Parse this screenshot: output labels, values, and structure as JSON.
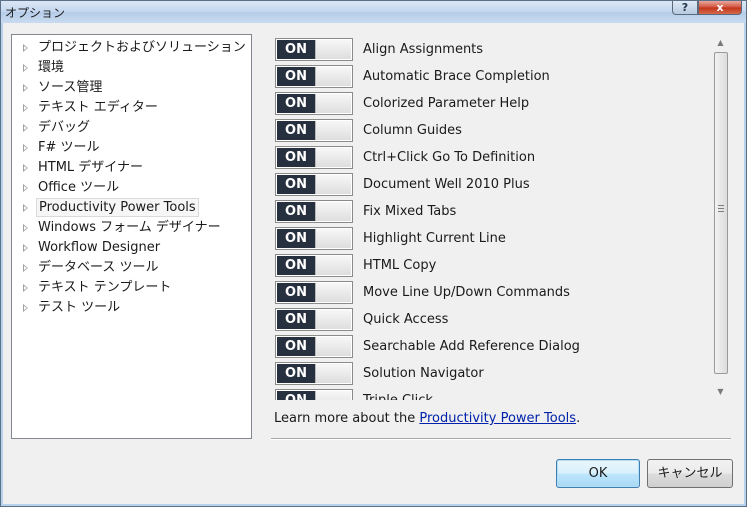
{
  "window": {
    "title": "オプション",
    "help_label": "?",
    "close_label": "x"
  },
  "tree": {
    "items": [
      {
        "label": "プロジェクトおよびソリューション"
      },
      {
        "label": "環境"
      },
      {
        "label": "ソース管理"
      },
      {
        "label": "テキスト エディター"
      },
      {
        "label": "デバッグ"
      },
      {
        "label": "F# ツール"
      },
      {
        "label": "HTML デザイナー"
      },
      {
        "label": "Office ツール"
      },
      {
        "label": "Productivity Power Tools",
        "selected": true
      },
      {
        "label": "Windows フォーム デザイナー"
      },
      {
        "label": "Workflow Designer"
      },
      {
        "label": "データベース ツール"
      },
      {
        "label": "テキスト テンプレート"
      },
      {
        "label": "テスト ツール"
      }
    ]
  },
  "options": {
    "items": [
      {
        "state": "ON",
        "label": "Align Assignments"
      },
      {
        "state": "ON",
        "label": "Automatic Brace Completion"
      },
      {
        "state": "ON",
        "label": "Colorized Parameter Help"
      },
      {
        "state": "ON",
        "label": "Column Guides"
      },
      {
        "state": "ON",
        "label": "Ctrl+Click Go To Definition"
      },
      {
        "state": "ON",
        "label": "Document Well 2010 Plus"
      },
      {
        "state": "ON",
        "label": "Fix Mixed Tabs"
      },
      {
        "state": "ON",
        "label": "Highlight Current Line"
      },
      {
        "state": "ON",
        "label": "HTML Copy"
      },
      {
        "state": "ON",
        "label": "Move Line Up/Down Commands"
      },
      {
        "state": "ON",
        "label": "Quick Access"
      },
      {
        "state": "ON",
        "label": "Searchable Add Reference Dialog"
      },
      {
        "state": "ON",
        "label": "Solution Navigator"
      },
      {
        "state": "ON",
        "label": "Triple Click"
      }
    ]
  },
  "learn_more": {
    "prefix": "Learn more about the ",
    "link": "Productivity Power Tools",
    "suffix": "."
  },
  "buttons": {
    "ok": "OK",
    "cancel": "キャンセル"
  }
}
